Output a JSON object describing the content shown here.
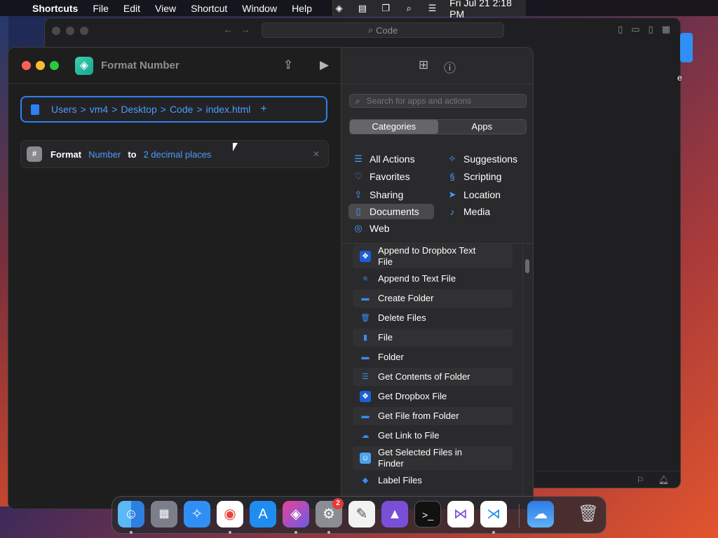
{
  "menubar": {
    "app": "Shortcuts",
    "items": [
      "File",
      "Edit",
      "View",
      "Shortcut",
      "Window",
      "Help"
    ],
    "clock": "Fri Jul 21  2:18 PM"
  },
  "bg_window": {
    "search": "Code",
    "edge_text": "e"
  },
  "shortcut": {
    "title": "Format Number",
    "path": [
      "Users",
      "vm4",
      "Desktop",
      "Code",
      "index.html"
    ],
    "path_sep": ">",
    "path_add": "+",
    "action": {
      "verb": "Format",
      "input": "Number",
      "joiner": "to",
      "option": "2 decimal places",
      "remove": "✕"
    }
  },
  "library": {
    "search_placeholder": "Search for apps and actions",
    "segments": [
      "Categories",
      "Apps"
    ],
    "selected_segment": "Categories",
    "categories": [
      {
        "label": "All Actions",
        "icon": "list-icon"
      },
      {
        "label": "Suggestions",
        "icon": "sparkle-icon"
      },
      {
        "label": "Favorites",
        "icon": "heart-icon"
      },
      {
        "label": "Scripting",
        "icon": "scripting-icon"
      },
      {
        "label": "Sharing",
        "icon": "share-icon"
      },
      {
        "label": "Location",
        "icon": "location-arrow-icon"
      },
      {
        "label": "Documents",
        "icon": "document-icon"
      },
      {
        "label": "Media",
        "icon": "music-note-icon"
      },
      {
        "label": "Web",
        "icon": "compass-icon"
      }
    ],
    "selected_category": "Documents",
    "actions": [
      {
        "label": "Append to Dropbox Text File",
        "icon": "dropbox-icon"
      },
      {
        "label": "Append to Text File",
        "icon": "text-file-icon"
      },
      {
        "label": "Create Folder",
        "icon": "folder-icon"
      },
      {
        "label": "Delete Files",
        "icon": "trash-icon"
      },
      {
        "label": "File",
        "icon": "file-icon"
      },
      {
        "label": "Folder",
        "icon": "folder-icon"
      },
      {
        "label": "Get Contents of Folder",
        "icon": "list-icon"
      },
      {
        "label": "Get Dropbox File",
        "icon": "dropbox-icon"
      },
      {
        "label": "Get File from Folder",
        "icon": "folder-icon"
      },
      {
        "label": "Get Link to File",
        "icon": "cloud-icon"
      },
      {
        "label": "Get Selected Files in Finder",
        "icon": "finder-icon"
      },
      {
        "label": "Label Files",
        "icon": "tag-icon"
      }
    ]
  },
  "dock": {
    "apps": [
      "Finder",
      "Launchpad",
      "Safari",
      "Chrome",
      "App Store",
      "Shortcuts",
      "System Settings",
      "TextEdit",
      "Xcode Instruments",
      "Terminal",
      "Visual Studio",
      "VS Code",
      "Weather",
      "Trash"
    ],
    "settings_badge": "2"
  },
  "colors": {
    "accent": "#2f7ff0",
    "link": "#4b9bff",
    "window_bg": "#1e1e1e",
    "library_bg": "#2a2a2c"
  }
}
